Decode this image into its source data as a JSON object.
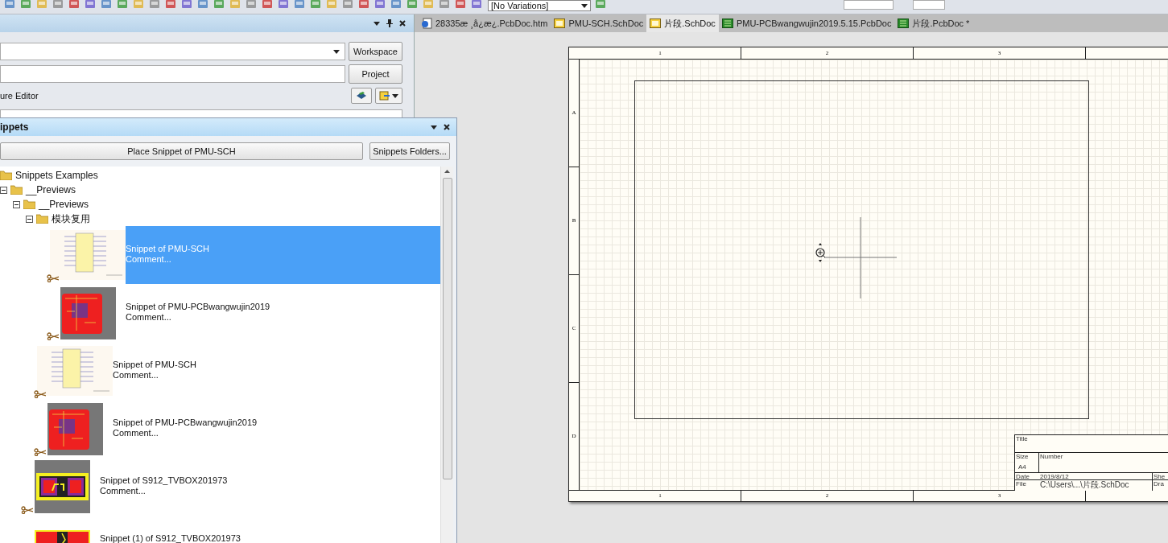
{
  "toolbar": {
    "variant_dropdown": "[No Variations]"
  },
  "left_panel": {
    "workspace_button": "Workspace",
    "project_button": "Project",
    "editor_label": "ure Editor"
  },
  "snippets_panel": {
    "title": "ippets",
    "place_button": "Place Snippet of PMU-SCH",
    "folders_button": "Snippets Folders...",
    "tree": [
      {
        "kind": "folder",
        "label": "Snippets Examples",
        "children": [
          {
            "kind": "folder",
            "label": "__Previews",
            "expanded": true,
            "children": [
              {
                "kind": "folder",
                "label": "__Previews",
                "expanded": true,
                "children": [
                  {
                    "kind": "folder",
                    "label": "模块复用",
                    "expanded": true,
                    "children": [
                      {
                        "kind": "snippet",
                        "thumbnail": {
                          "kind": "schematic"
                        },
                        "name": "Snippet of PMU-SCH",
                        "comment": "Comment...",
                        "selected": true
                      },
                      {
                        "kind": "snippet",
                        "thumbnail": {
                          "kind": "pcb"
                        },
                        "name": "Snippet of PMU-PCBwangwujin2019",
                        "comment": "Comment...",
                        "selected": false
                      }
                    ]
                  },
                  {
                    "kind": "snippet",
                    "thumbnail": {
                      "kind": "schematic"
                    },
                    "name": "Snippet of PMU-SCH",
                    "comment": "Comment...",
                    "selected": false
                  },
                  {
                    "kind": "snippet",
                    "thumbnail": {
                      "kind": "pcb"
                    },
                    "name": "Snippet of PMU-PCBwangwujin2019",
                    "comment": "Comment...",
                    "selected": false
                  }
                ]
              },
              {
                "kind": "snippet",
                "thumbnail": {
                  "kind": "resistor"
                },
                "name": "Snippet of S912_TVBOX201973",
                "comment": "Comment...",
                "selected": false
              },
              {
                "kind": "snippet",
                "thumbnail": {
                  "kind": "pad"
                },
                "name": "Snippet (1) of S912_TVBOX201973",
                "selected": false
              }
            ]
          }
        ]
      }
    ]
  },
  "tabs": [
    {
      "label": "28335æ ¸å¿æ¿.PcbDoc.htm",
      "kind": "web",
      "selected": false
    },
    {
      "label": "PMU-SCH.SchDoc",
      "kind": "sch",
      "selected": false
    },
    {
      "label": "片段.SchDoc",
      "kind": "sch",
      "selected": true
    },
    {
      "label": "PMU-PCBwangwujin2019.5.15.PcbDoc",
      "kind": "pcb",
      "selected": false
    },
    {
      "label": "片段.PcbDoc *",
      "kind": "pcb",
      "selected": false
    }
  ],
  "sheet": {
    "top_zones": [
      "1",
      "2",
      "3"
    ],
    "bottom_zones": [
      "1",
      "2",
      "3"
    ],
    "left_zones": [
      "A",
      "B",
      "C",
      "D"
    ],
    "title_block": {
      "title_label": "Title",
      "size_label": "Size",
      "size": "A4",
      "number_label": "Number",
      "date_label": "Date",
      "date": "2019/8/12",
      "sheet_label": "She",
      "file_label": "File",
      "file": "C:\\Users\\...\\片段.SchDoc",
      "drawn_label": "Dra"
    }
  }
}
